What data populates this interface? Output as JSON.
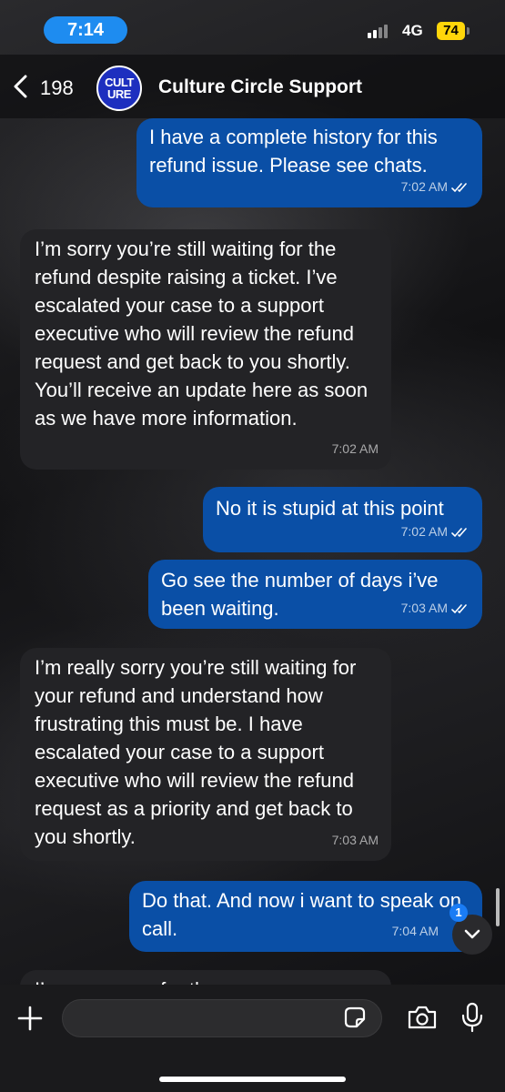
{
  "status_bar": {
    "time": "7:14",
    "network": "4G",
    "battery": "74"
  },
  "header": {
    "back_count": "198",
    "avatar_line1": "CULT",
    "avatar_line2": "URE",
    "title": "Culture Circle Support"
  },
  "messages": [
    {
      "direction": "outgoing",
      "text": "I have a complete history for this refund issue. Please see chats.",
      "time": "7:02 AM",
      "read": true
    },
    {
      "direction": "incoming",
      "text": "I’m sorry you’re still waiting for the refund despite raising a ticket. I’ve escalated your case to a support executive who will review the refund request and get back to you shortly. You’ll receive an update here as soon as we have more information.",
      "time": "7:02 AM"
    },
    {
      "direction": "outgoing",
      "text": "No it is stupid at this point",
      "time": "7:02 AM",
      "read": true
    },
    {
      "direction": "outgoing",
      "text": "Go see the number of days i’ve been waiting.",
      "time": "7:03 AM",
      "read": true
    },
    {
      "direction": "incoming",
      "text": "I’m really sorry you’re still waiting for your refund and understand how frustrating this must be. I have escalated your case to a support executive who will review the refund request as a priority and get back to you shortly.",
      "time": "7:03 AM"
    },
    {
      "direction": "outgoing",
      "text": "Do that. And now i want to speak on call.",
      "time": "7:04 AM",
      "read": true
    },
    {
      "direction": "incoming",
      "text": "I’m very sorry for the",
      "time": ""
    }
  ],
  "jump_badge": "1",
  "icons": [
    "back-chevron-icon",
    "read-ticks-icon",
    "chevron-down-icon",
    "plus-icon",
    "sticker-icon",
    "camera-icon",
    "mic-icon"
  ]
}
